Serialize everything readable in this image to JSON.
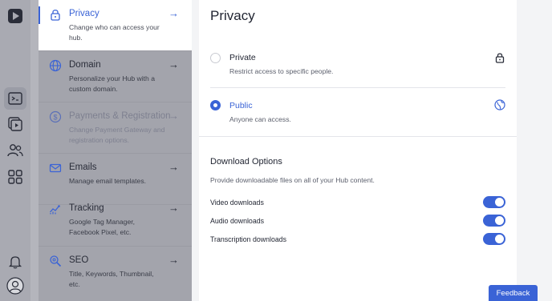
{
  "rail": {
    "icons": [
      "logo-icon",
      "hub-icon",
      "videos-icon",
      "people-icon",
      "apps-icon",
      "notifications-icon",
      "profile-icon"
    ]
  },
  "settings_list": {
    "items": [
      {
        "title": "Privacy",
        "desc": "Change who can access your hub.",
        "icon": "lock-icon",
        "state": "active"
      },
      {
        "title": "Domain",
        "desc": "Personalize your Hub with a custom domain.",
        "icon": "globe-icon",
        "state": "normal"
      },
      {
        "title": "Payments & Registration",
        "desc": "Change Payment Gateway and registration options.",
        "icon": "dollar-icon",
        "state": "disabled"
      },
      {
        "title": "Emails",
        "desc": "Manage email templates.",
        "icon": "mail-icon",
        "state": "normal"
      },
      {
        "title": "Tracking",
        "desc": "Google Tag Manager, Facebook Pixel, etc.",
        "icon": "chart-icon",
        "state": "normal"
      },
      {
        "title": "SEO",
        "desc": "Title, Keywords, Thumbnail, etc.",
        "icon": "seo-icon",
        "state": "normal"
      }
    ],
    "arrow": "→"
  },
  "privacy": {
    "title": "Privacy",
    "options": [
      {
        "label": "Private",
        "desc": "Restrict access to specific people.",
        "selected": false,
        "icon": "lock-icon"
      },
      {
        "label": "Public",
        "desc": "Anyone can access.",
        "selected": true,
        "icon": "globe-icon"
      }
    ]
  },
  "download": {
    "title": "Download Options",
    "desc": "Provide downloadable files on all of your Hub content.",
    "toggles": [
      {
        "label": "Video downloads",
        "on": true
      },
      {
        "label": "Audio downloads",
        "on": true
      },
      {
        "label": "Transcription downloads",
        "on": true
      }
    ]
  },
  "feedback_label": "Feedback",
  "colors": {
    "accent": "#3a63d6",
    "overlay": "#a3a4ac"
  }
}
